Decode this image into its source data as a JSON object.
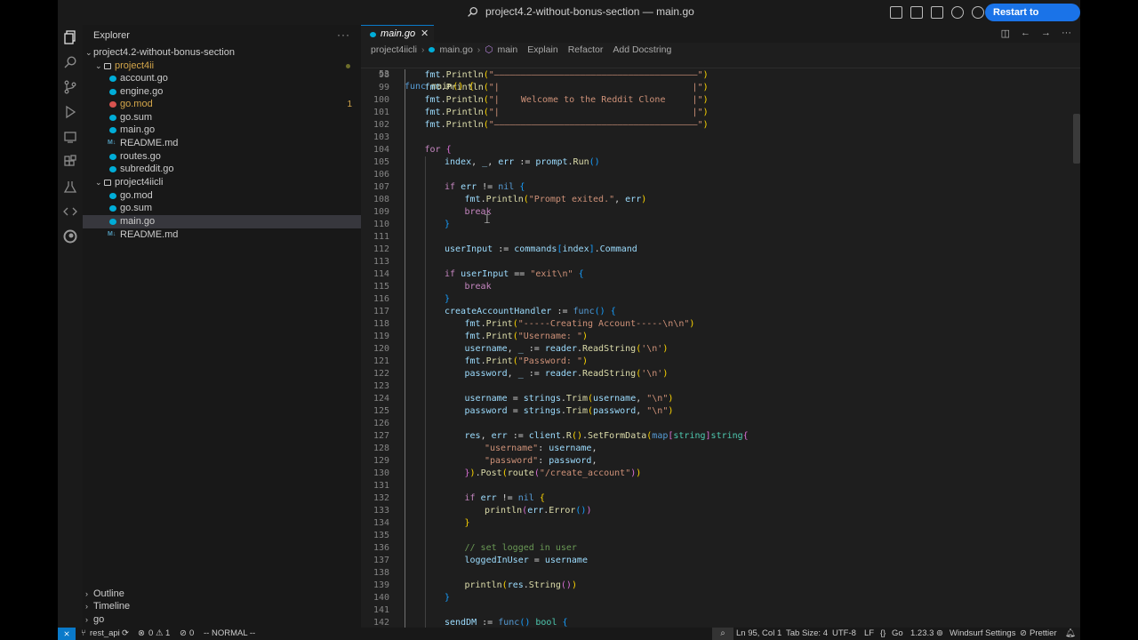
{
  "window": {
    "title": "project4.2-without-bonus-section — main.go",
    "update_button": "Restart to Update →"
  },
  "sidebar": {
    "header": "Explorer",
    "root": "project4.2-without-bonus-section",
    "folders": [
      {
        "name": "project4ii",
        "files": [
          {
            "name": "account.go",
            "type": "go"
          },
          {
            "name": "engine.go",
            "type": "go"
          },
          {
            "name": "go.mod",
            "type": "mod",
            "badge": "1"
          },
          {
            "name": "go.sum",
            "type": "sum"
          },
          {
            "name": "main.go",
            "type": "go"
          },
          {
            "name": "README.md",
            "type": "md"
          },
          {
            "name": "routes.go",
            "type": "go"
          },
          {
            "name": "subreddit.go",
            "type": "go"
          }
        ]
      },
      {
        "name": "project4iicli",
        "files": [
          {
            "name": "go.mod",
            "type": "go"
          },
          {
            "name": "go.sum",
            "type": "sum"
          },
          {
            "name": "main.go",
            "type": "go",
            "selected": true
          },
          {
            "name": "README.md",
            "type": "md"
          }
        ]
      }
    ],
    "md_icon_text": "M↓",
    "bottom_sections": [
      "Outline",
      "Timeline",
      "go"
    ]
  },
  "editor": {
    "tab": {
      "label": "main.go",
      "close": "✕"
    },
    "breadcrumb": [
      "project4iicli",
      "main.go",
      "main"
    ],
    "breadcrumb_actions": [
      "Explain",
      "Refactor",
      "Add Docstring"
    ],
    "sticky": {
      "line": "53",
      "text": "func main() {"
    }
  },
  "code_lines": [
    {
      "n": "98",
      "i": 1,
      "h": "<span class='v'>fmt</span>.<span class='f'>Println</span><span class='p'>(</span><span class='s'>\"——————————————————————————————————————\"</span><span class='p'>)</span>"
    },
    {
      "n": "99",
      "i": 1,
      "h": "<span class='v'>fmt</span>.<span class='f'>Println</span><span class='p'>(</span><span class='s'>\"|                                    |\"</span><span class='p'>)</span>"
    },
    {
      "n": "100",
      "i": 1,
      "h": "<span class='v'>fmt</span>.<span class='f'>Println</span><span class='p'>(</span><span class='s'>\"|    Welcome to the Reddit Clone     |\"</span><span class='p'>)</span>"
    },
    {
      "n": "101",
      "i": 1,
      "h": "<span class='v'>fmt</span>.<span class='f'>Println</span><span class='p'>(</span><span class='s'>\"|                                    |\"</span><span class='p'>)</span>"
    },
    {
      "n": "102",
      "i": 1,
      "h": "<span class='v'>fmt</span>.<span class='f'>Println</span><span class='p'>(</span><span class='s'>\"——————————————————————————————————————\"</span><span class='p'>)</span>"
    },
    {
      "n": "103",
      "i": 0,
      "h": ""
    },
    {
      "n": "104",
      "i": 1,
      "h": "<span class='k'>for</span> <span class='p2'>{</span>"
    },
    {
      "n": "105",
      "i": 2,
      "h": "<span class='v'>index</span>, <span class='v'>_</span>, <span class='v'>err</span> := <span class='v'>prompt</span>.<span class='f'>Run</span><span class='p3'>()</span>"
    },
    {
      "n": "106",
      "i": 0,
      "h": ""
    },
    {
      "n": "107",
      "i": 2,
      "h": "<span class='k'>if</span> <span class='v'>err</span> != <span class='kw'>nil</span> <span class='p3'>{</span>"
    },
    {
      "n": "108",
      "i": 3,
      "h": "<span class='v'>fmt</span>.<span class='f'>Println</span><span class='p'>(</span><span class='s'>\"Prompt exited.\"</span>, <span class='v'>err</span><span class='p'>)</span>"
    },
    {
      "n": "109",
      "i": 3,
      "h": "<span class='k'>break</span>"
    },
    {
      "n": "110",
      "i": 2,
      "h": "<span class='p3'>}</span>"
    },
    {
      "n": "111",
      "i": 0,
      "h": ""
    },
    {
      "n": "112",
      "i": 2,
      "h": "<span class='v'>userInput</span> := <span class='v'>commands</span><span class='p3'>[</span><span class='v'>index</span><span class='p3'>]</span>.<span class='v'>Command</span>"
    },
    {
      "n": "113",
      "i": 0,
      "h": ""
    },
    {
      "n": "114",
      "i": 2,
      "h": "<span class='k'>if</span> <span class='v'>userInput</span> == <span class='s'>\"exit\\n\"</span> <span class='p3'>{</span>"
    },
    {
      "n": "115",
      "i": 3,
      "h": "<span class='k'>break</span>"
    },
    {
      "n": "116",
      "i": 2,
      "h": "<span class='p3'>}</span>"
    },
    {
      "n": "117",
      "i": 2,
      "h": "<span class='v'>createAccountHandler</span> := <span class='kw'>func</span><span class='p3'>()</span> <span class='p3'>{</span>"
    },
    {
      "n": "118",
      "i": 3,
      "h": "<span class='v'>fmt</span>.<span class='f'>Print</span><span class='p'>(</span><span class='s'>\"-----Creating Account-----\\n\\n\"</span><span class='p'>)</span>"
    },
    {
      "n": "119",
      "i": 3,
      "h": "<span class='v'>fmt</span>.<span class='f'>Print</span><span class='p'>(</span><span class='s'>\"Username: \"</span><span class='p'>)</span>"
    },
    {
      "n": "120",
      "i": 3,
      "h": "<span class='v'>username</span>, <span class='v'>_</span> := <span class='v'>reader</span>.<span class='f'>ReadString</span><span class='p'>(</span><span class='s'>'\\n'</span><span class='p'>)</span>"
    },
    {
      "n": "121",
      "i": 3,
      "h": "<span class='v'>fmt</span>.<span class='f'>Print</span><span class='p'>(</span><span class='s'>\"Password: \"</span><span class='p'>)</span>"
    },
    {
      "n": "122",
      "i": 3,
      "h": "<span class='v'>password</span>, <span class='v'>_</span> := <span class='v'>reader</span>.<span class='f'>ReadString</span><span class='p'>(</span><span class='s'>'\\n'</span><span class='p'>)</span>"
    },
    {
      "n": "123",
      "i": 0,
      "h": ""
    },
    {
      "n": "124",
      "i": 3,
      "h": "<span class='v'>username</span> = <span class='v'>strings</span>.<span class='f'>Trim</span><span class='p'>(</span><span class='v'>username</span>, <span class='s'>\"\\n\"</span><span class='p'>)</span>"
    },
    {
      "n": "125",
      "i": 3,
      "h": "<span class='v'>password</span> = <span class='v'>strings</span>.<span class='f'>Trim</span><span class='p'>(</span><span class='v'>password</span>, <span class='s'>\"\\n\"</span><span class='p'>)</span>"
    },
    {
      "n": "126",
      "i": 0,
      "h": ""
    },
    {
      "n": "127",
      "i": 3,
      "h": "<span class='v'>res</span>, <span class='v'>err</span> := <span class='v'>client</span>.<span class='f'>R</span><span class='p'>()</span>.<span class='f'>SetFormData</span><span class='p'>(</span><span class='kw'>map</span><span class='p2'>[</span><span class='t'>string</span><span class='p2'>]</span><span class='t'>string</span><span class='p2'>{</span>"
    },
    {
      "n": "128",
      "i": 4,
      "h": "<span class='s'>\"username\"</span>: <span class='v'>username</span>,"
    },
    {
      "n": "129",
      "i": 4,
      "h": "<span class='s'>\"password\"</span>: <span class='v'>password</span>,"
    },
    {
      "n": "130",
      "i": 3,
      "h": "<span class='p2'>}</span><span class='p'>)</span>.<span class='f'>Post</span><span class='p'>(</span><span class='f'>route</span><span class='p2'>(</span><span class='s'>\"/create_account\"</span><span class='p2'>)</span><span class='p'>)</span>"
    },
    {
      "n": "131",
      "i": 0,
      "h": ""
    },
    {
      "n": "132",
      "i": 3,
      "h": "<span class='k'>if</span> <span class='v'>err</span> != <span class='kw'>nil</span> <span class='p'>{</span>"
    },
    {
      "n": "133",
      "i": 4,
      "h": "<span class='f'>println</span><span class='p2'>(</span><span class='v'>err</span>.<span class='f'>Error</span><span class='p3'>()</span><span class='p2'>)</span>"
    },
    {
      "n": "134",
      "i": 3,
      "h": "<span class='p'>}</span>"
    },
    {
      "n": "135",
      "i": 0,
      "h": ""
    },
    {
      "n": "136",
      "i": 3,
      "h": "<span class='c'>// set logged in user</span>"
    },
    {
      "n": "137",
      "i": 3,
      "h": "<span class='v'>loggedInUser</span> = <span class='v'>username</span>"
    },
    {
      "n": "138",
      "i": 0,
      "h": ""
    },
    {
      "n": "139",
      "i": 3,
      "h": "<span class='f'>println</span><span class='p'>(</span><span class='v'>res</span>.<span class='f'>String</span><span class='p2'>()</span><span class='p'>)</span>"
    },
    {
      "n": "140",
      "i": 2,
      "h": "<span class='p3'>}</span>"
    },
    {
      "n": "141",
      "i": 0,
      "h": ""
    },
    {
      "n": "142",
      "i": 2,
      "h": "<span class='v'>sendDM</span> := <span class='kw'>func</span><span class='p3'>()</span> <span class='t'>bool</span> <span class='p3'>{</span>"
    }
  ],
  "status": {
    "branch": "rest_api",
    "errors": "0",
    "warnings": "1",
    "ports": "0",
    "mode": "-- NORMAL --",
    "position": "Ln 95, Col 1",
    "tab_size": "Tab Size: 4",
    "encoding": "UTF-8",
    "eol": "LF",
    "language": "Go",
    "go_version": "1.23.3",
    "windsurf": "Windsurf Settings",
    "prettier": "Prettier"
  },
  "colors": {
    "accent": "#0a7aca",
    "update_button": "#1a73e8",
    "editor_bg": "#1e1e1e",
    "sidebar_bg": "#181818"
  }
}
